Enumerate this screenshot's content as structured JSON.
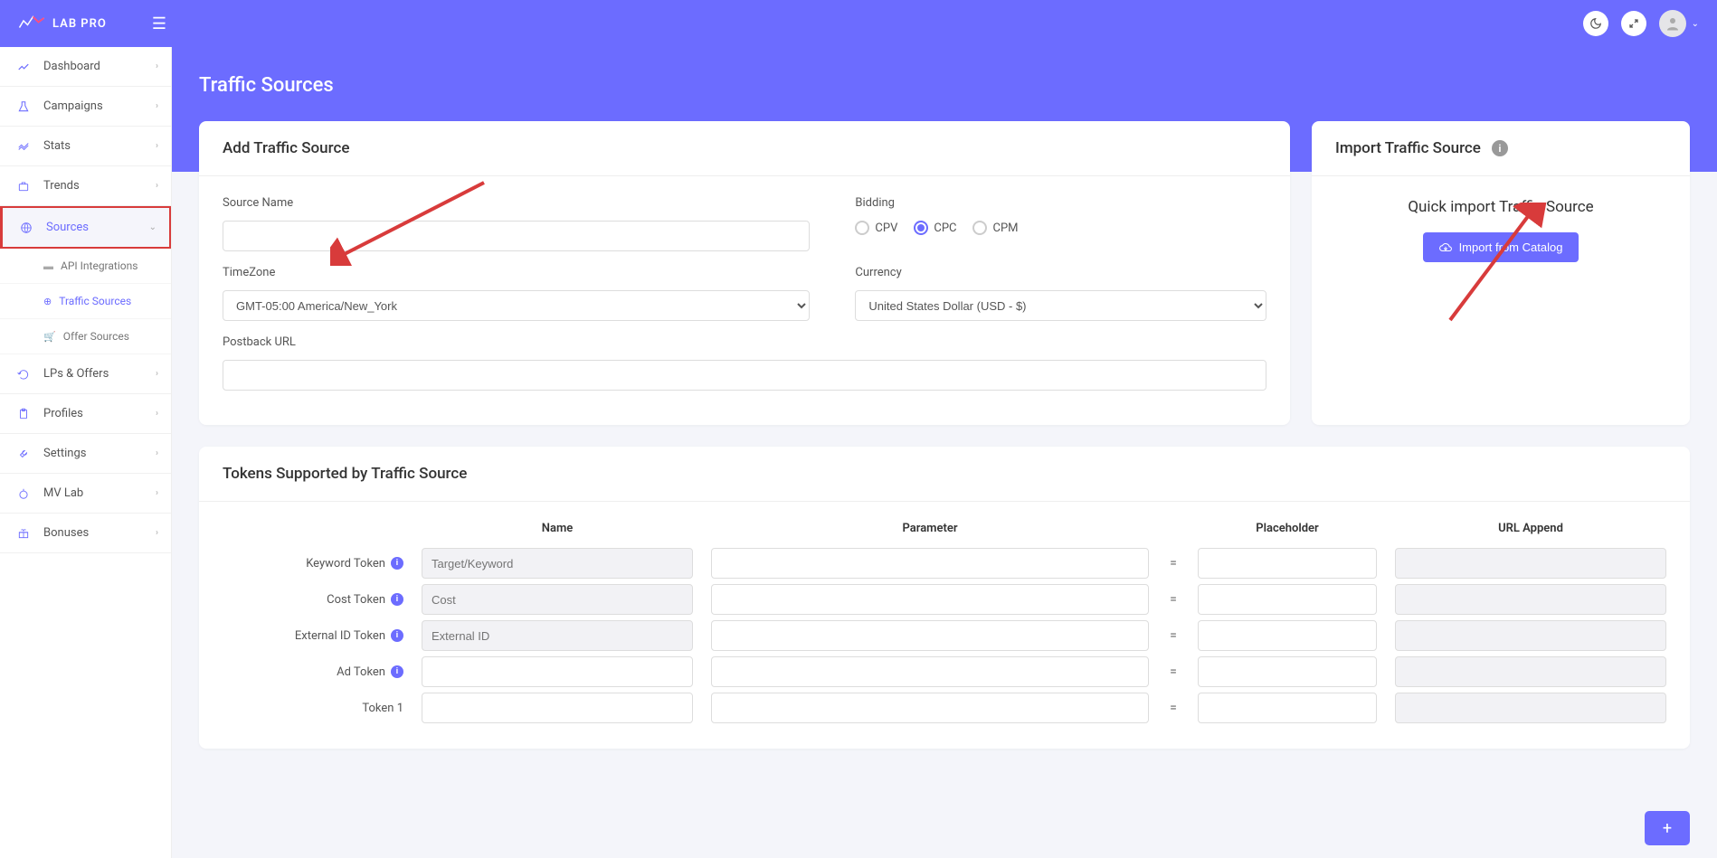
{
  "header": {
    "logo_text": "LAB PRO"
  },
  "page_title": "Traffic Sources",
  "sidebar": {
    "items": [
      {
        "label": "Dashboard"
      },
      {
        "label": "Campaigns"
      },
      {
        "label": "Stats"
      },
      {
        "label": "Trends"
      },
      {
        "label": "Sources"
      },
      {
        "label": "LPs & Offers"
      },
      {
        "label": "Profiles"
      },
      {
        "label": "Settings"
      },
      {
        "label": "MV Lab"
      },
      {
        "label": "Bonuses"
      }
    ],
    "sub_items": [
      {
        "label": "API Integrations"
      },
      {
        "label": "Traffic Sources"
      },
      {
        "label": "Offer Sources"
      }
    ]
  },
  "add_card": {
    "title": "Add Traffic Source",
    "source_name_label": "Source Name",
    "bidding_label": "Bidding",
    "bidding_options": [
      "CPV",
      "CPC",
      "CPM"
    ],
    "timezone_label": "TimeZone",
    "timezone_value": "GMT-05:00 America/New_York",
    "currency_label": "Currency",
    "currency_value": "United States Dollar (USD - $)",
    "postback_label": "Postback URL"
  },
  "import_card": {
    "title": "Import Traffic Source",
    "subtitle": "Quick import Traffic Source",
    "button": "Import from Catalog"
  },
  "tokens_card": {
    "title": "Tokens Supported by Traffic Source",
    "headers": {
      "name": "Name",
      "parameter": "Parameter",
      "placeholder": "Placeholder",
      "url_append": "URL Append"
    },
    "rows": [
      {
        "label": "Keyword Token",
        "name_placeholder": "Target/Keyword",
        "disabled": true,
        "info": true
      },
      {
        "label": "Cost Token",
        "name_placeholder": "Cost",
        "disabled": true,
        "info": true
      },
      {
        "label": "External ID Token",
        "name_placeholder": "External ID",
        "disabled": true,
        "info": true
      },
      {
        "label": "Ad Token",
        "name_placeholder": "",
        "disabled": false,
        "info": true
      },
      {
        "label": "Token 1",
        "name_placeholder": "",
        "disabled": false,
        "info": false
      }
    ],
    "eq": "="
  }
}
